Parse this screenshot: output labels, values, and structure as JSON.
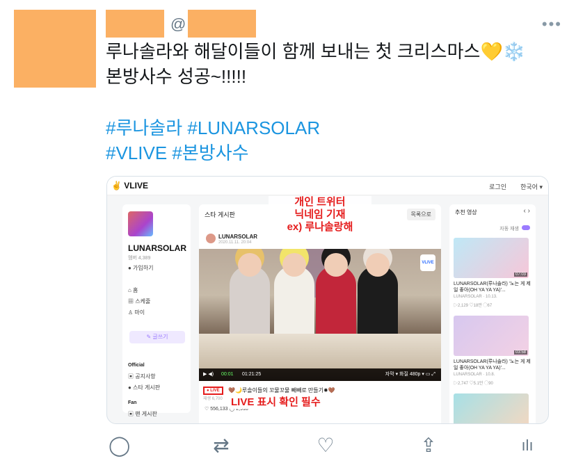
{
  "tweet": {
    "at": "@",
    "more": "•••",
    "text": "루나솔라와 해달이들이 함께 보내는 첫 크리스마스💛❄️\n본방사수 성공~!!!!!",
    "hashtags": [
      "#루나솔라 #LUNARSOLAR",
      "#VLIVE #본방사수"
    ],
    "colors": {
      "redact": "#fbb063",
      "link": "#1b95e0",
      "text": "#14171a"
    }
  },
  "card": {
    "logo": "VLIVE",
    "login": "로그인",
    "lang": "한국어 ▾",
    "sidebar": {
      "channel": "LUNARSOLAR",
      "members": "멤버 4,389",
      "join": "● 가입하기",
      "nav": [
        "⌂ 홈",
        "▦ 스케줄",
        "♙ 마이"
      ],
      "write": "✎ 글쓰기",
      "section_official": "Official",
      "official_items": [
        "▣ 공지사항",
        "● 스타 게시판"
      ],
      "section_fan": "Fan",
      "fan_items": [
        "▣ 팬 게시판"
      ]
    },
    "main": {
      "board_title": "스타 게시판",
      "to_list": "목록으로",
      "post_author": "LUNARSOLAR",
      "post_date": "2020.11.11. 20:04",
      "video_time": "00:01",
      "video_duration": "01:21:25",
      "video_controls": "자막 ▾   화질 480p ▾   ▭   ⤢",
      "badge": "VLIVE",
      "live_label": "● LIVE",
      "post_title": "🤎🌙루솔이들의 꼬물꼬물 빼빼로 만들기✸🤎",
      "views": "재생 6,700",
      "stats": "♡ 556,133   ◯ 2,918"
    },
    "overlay": {
      "nick_lines": [
        "개인 트위터",
        "닉네임 기재",
        "ex) 루나솔랑해"
      ],
      "live": "LIVE 표시 확인 필수"
    },
    "recommended": {
      "title": "추천 영상",
      "nav": "‹   ›",
      "autoplay": "자동 재생",
      "items": [
        {
          "title": "LUNARSOLAR(루나솔라) '노는 게 제일 좋아(OH YA YA YA)'...",
          "channel": "LUNARSOLAR · 10.13.",
          "stats": "▷2,129  ♡18만  ◯67",
          "duration": "07:03"
        },
        {
          "title": "LUNARSOLAR(루나솔라) '노는 게 제일 좋아(OH YA YA YA)'...",
          "channel": "LUNARSOLAR · 10.8.",
          "stats": "▷2,747  ♡5.1만  ◯90",
          "duration": "03:58"
        }
      ]
    }
  },
  "actions": {
    "reply": "◯",
    "retweet": "⇄",
    "like": "♡",
    "share": "⇪",
    "analytics": "ılı"
  }
}
